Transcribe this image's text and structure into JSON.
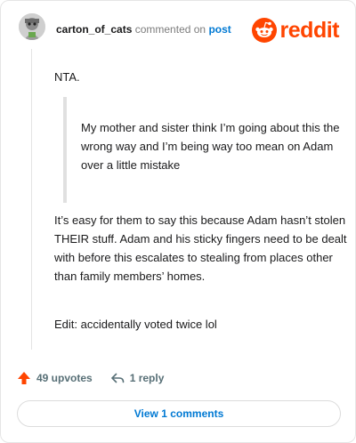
{
  "header": {
    "author": "carton_of_cats",
    "action_text": "commented on",
    "post_link": "post",
    "logo_text": "reddit"
  },
  "comment": {
    "opening": "NTA.",
    "quote": "My mother and sister think I’m going about this the wrong way and I’m being way too mean on Adam over a little mistake",
    "paragraph": "It’s easy for them to say this because Adam hasn’t stolen THEIR stuff. Adam and his sticky fingers need to be dealt with before this escalates to stealing from places other than family members’ homes.",
    "edit": "Edit: accidentally voted twice lol"
  },
  "actions": {
    "upvotes_label": "49 upvotes",
    "reply_label": "1 reply"
  },
  "footer": {
    "view_comments_label": "View 1 comments"
  },
  "colors": {
    "brand": "#ff4500",
    "link": "#0079d3",
    "muted": "#7c7c7c",
    "text": "#1a1a1b"
  }
}
